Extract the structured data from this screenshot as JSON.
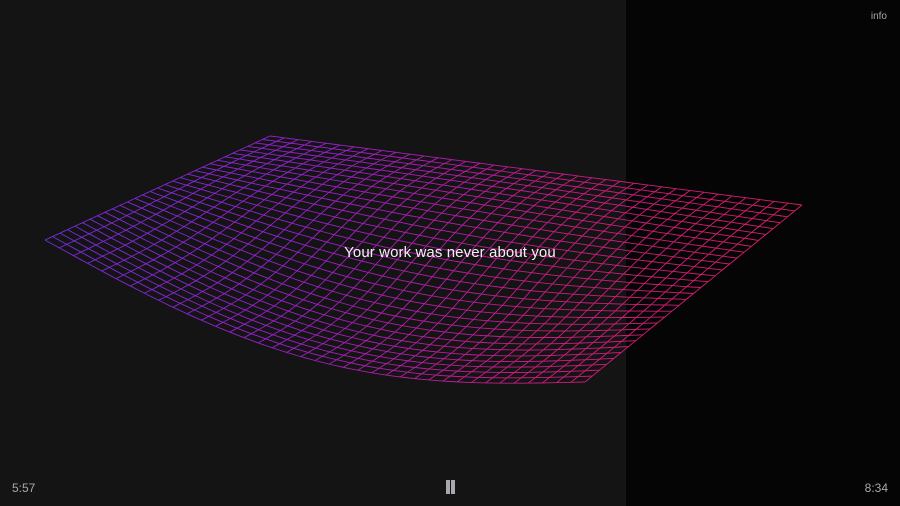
{
  "info_label": "info",
  "caption": "Your work was never about you",
  "player": {
    "elapsed": "5:57",
    "remaining": "8:34",
    "state": "playing",
    "control_icon": "pause-icon"
  },
  "colors": {
    "background": "#141415",
    "panel": "#050506",
    "text": "#f2f2f2",
    "muted": "#a9a9ad",
    "mesh_start": "#8a2be2",
    "mesh_end": "#e8206a"
  }
}
